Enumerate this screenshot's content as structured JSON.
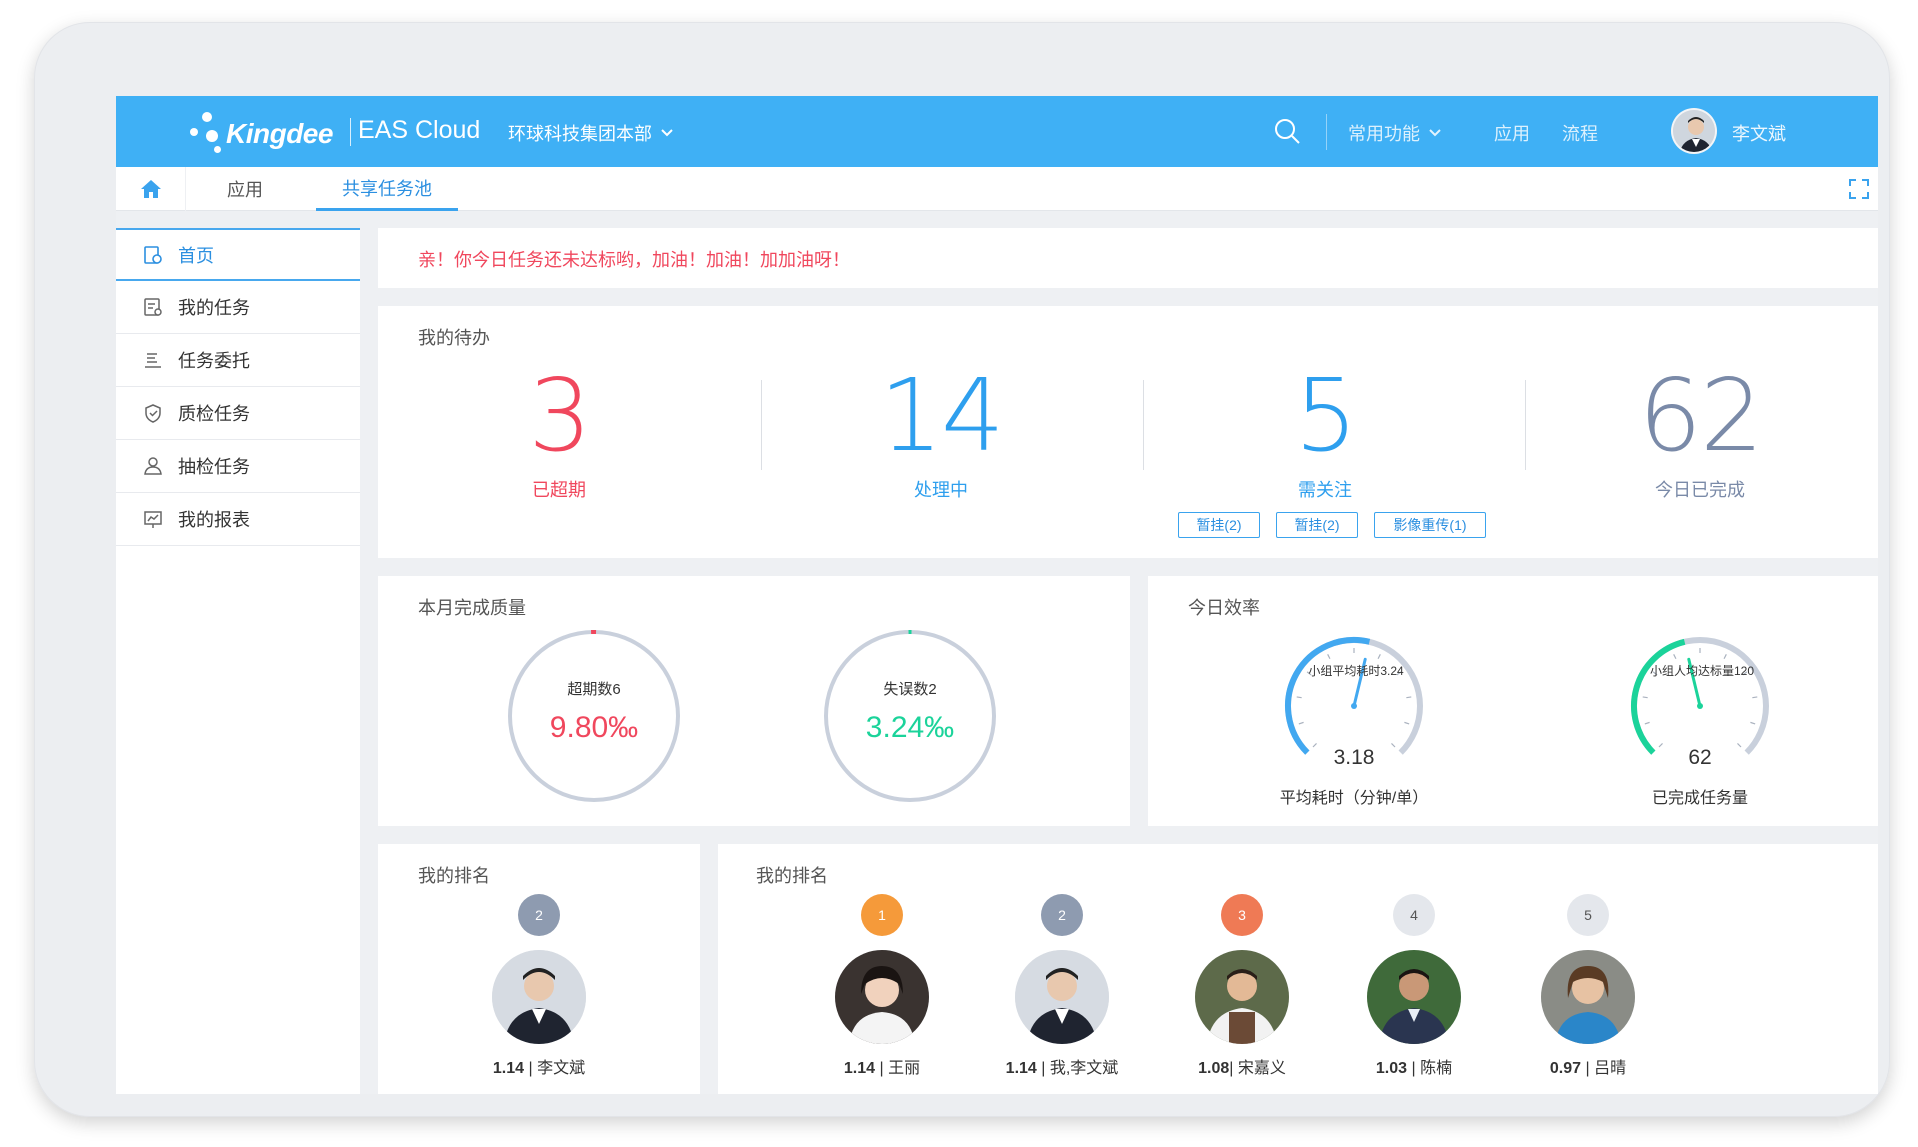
{
  "header": {
    "brand": "Kingdee",
    "product": "EAS Cloud",
    "org": "环球科技集团本部",
    "common_functions": "常用功能",
    "apps": "应用",
    "process": "流程",
    "username": "李文斌",
    "accent": "#3fb0f5"
  },
  "tabs": [
    {
      "label": "应用"
    },
    {
      "label": "共享任务池"
    }
  ],
  "sidebar": {
    "items": [
      {
        "label": "首页",
        "icon": "home-doc-icon"
      },
      {
        "label": "我的任务",
        "icon": "task-icon"
      },
      {
        "label": "任务委托",
        "icon": "delegate-icon"
      },
      {
        "label": "质检任务",
        "icon": "quality-check-icon"
      },
      {
        "label": "抽检任务",
        "icon": "sample-check-icon"
      },
      {
        "label": "我的报表",
        "icon": "report-icon"
      }
    ]
  },
  "alert": {
    "text": "亲！你今日任务还未达标哟，加油！加油！加加油呀！"
  },
  "todo": {
    "title": "我的待办",
    "stats": [
      {
        "value": "3",
        "label": "已超期",
        "color": "#f0475d"
      },
      {
        "value": "14",
        "label": "处理中",
        "color": "#2e9fee"
      },
      {
        "value": "5",
        "label": "需关注",
        "color": "#2e9fee"
      },
      {
        "value": "62",
        "label": "今日已完成",
        "color": "#7a8aa8"
      }
    ],
    "tags": [
      "暂挂(2)",
      "暂挂(2)",
      "影像重传(1)"
    ]
  },
  "quality": {
    "title": "本月完成质量",
    "rings": [
      {
        "caption": "超期数6",
        "value": "9.80‰",
        "color": "#f0475d"
      },
      {
        "caption": "失误数2",
        "value": "3.24‰",
        "color": "#1bd39a"
      }
    ]
  },
  "efficiency": {
    "title": "今日效率",
    "gauges": [
      {
        "caption": "小组平均耗时3.24",
        "value": "3.18",
        "label": "平均耗时（分钟/单）",
        "fraction": 0.55,
        "color": "#42a8f0"
      },
      {
        "caption": "小组人均达标量120",
        "value": "62",
        "label": "已完成任务量",
        "fraction": 0.45,
        "color": "#1bd39a"
      }
    ]
  },
  "my_rank": {
    "title": "我的排名",
    "badge": "2",
    "score": "1.14",
    "name": "李文斌"
  },
  "ranking": {
    "title": "我的排名",
    "items": [
      {
        "badge": "1",
        "score": "1.14",
        "name": "王丽"
      },
      {
        "badge": "2",
        "score": "1.14",
        "name": "我,李文斌"
      },
      {
        "badge": "3",
        "score": "1.08",
        "name": "宋嘉义"
      },
      {
        "badge": "4",
        "score": "1.03",
        "name": "陈楠"
      },
      {
        "badge": "5",
        "score": "0.97",
        "name": "吕晴"
      }
    ]
  }
}
